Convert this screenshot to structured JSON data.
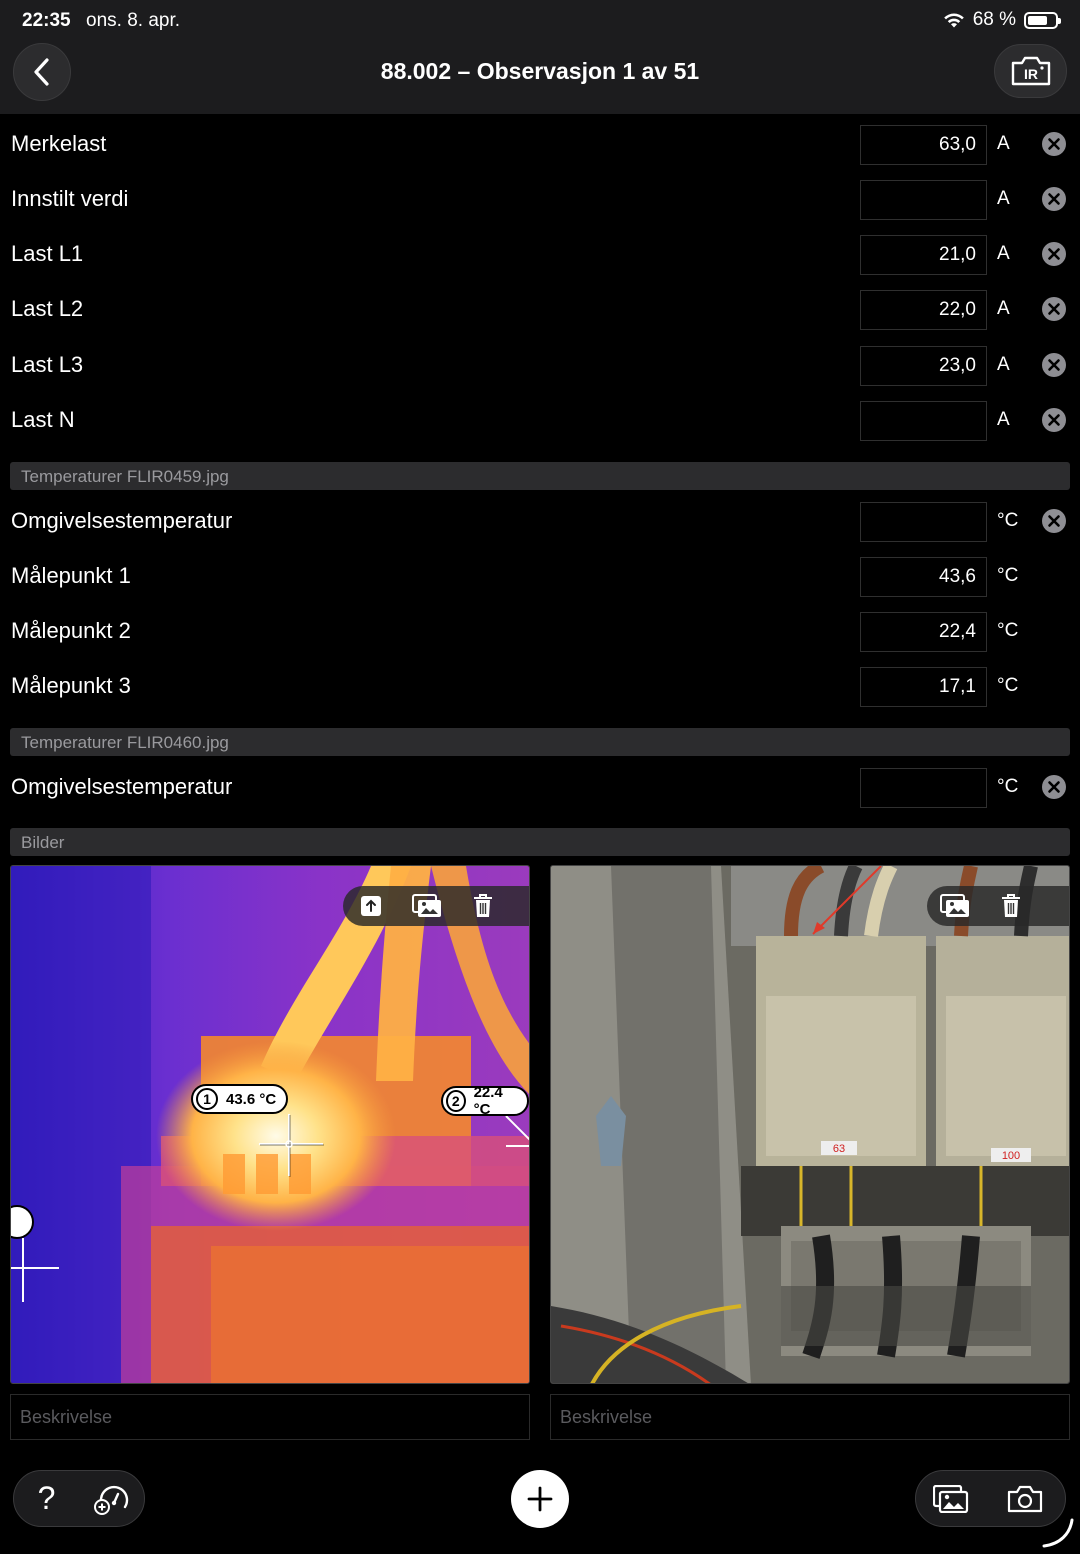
{
  "status": {
    "time": "22:35",
    "date": "ons. 8. apr.",
    "battery": "68 %"
  },
  "header": {
    "title": "88.002 – Observasjon 1 av 51"
  },
  "rows": [
    {
      "label": "Merkelast",
      "value": "63,0",
      "unit": "A",
      "clearable": true
    },
    {
      "label": "Innstilt verdi",
      "value": "",
      "unit": "A",
      "clearable": true
    },
    {
      "label": "Last L1",
      "value": "21,0",
      "unit": "A",
      "clearable": true
    },
    {
      "label": "Last L2",
      "value": "22,0",
      "unit": "A",
      "clearable": true
    },
    {
      "label": "Last L3",
      "value": "23,0",
      "unit": "A",
      "clearable": true
    },
    {
      "label": "Last N",
      "value": "",
      "unit": "A",
      "clearable": true
    }
  ],
  "section1": {
    "title": "Temperaturer FLIR0459.jpg"
  },
  "temps1": [
    {
      "label": "Omgivelsestemperatur",
      "value": "",
      "unit": "°C",
      "clearable": true
    },
    {
      "label": "Målepunkt 1",
      "value": "43,6",
      "unit": "°C",
      "clearable": false
    },
    {
      "label": "Målepunkt 2",
      "value": "22,4",
      "unit": "°C",
      "clearable": false
    },
    {
      "label": "Målepunkt 3",
      "value": "17,1",
      "unit": "°C",
      "clearable": false
    }
  ],
  "section2": {
    "title": "Temperaturer FLIR0460.jpg"
  },
  "temps2": [
    {
      "label": "Omgivelsestemperatur",
      "value": "",
      "unit": "°C",
      "clearable": true
    }
  ],
  "section3": {
    "title": "Bilder"
  },
  "images": {
    "thermal": {
      "marker1_num": "1",
      "marker1_temp": "43.6 °C",
      "marker2_num": "2",
      "marker2_temp": "22.4 °C"
    },
    "description_placeholder": "Beskrivelse"
  },
  "bottom": {
    "help": "?"
  },
  "colors": {
    "background": "#000000",
    "header": "#1c1c1e",
    "section": "#2c2c2e"
  }
}
